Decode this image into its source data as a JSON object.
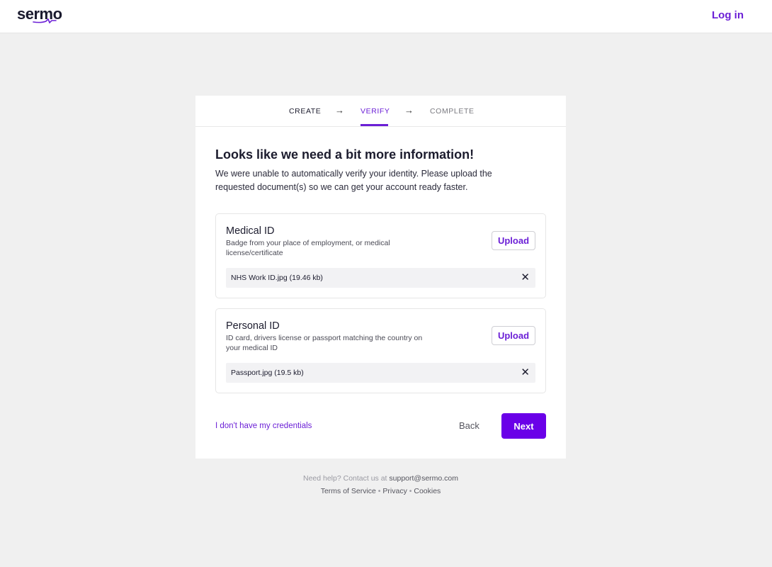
{
  "header": {
    "logo_text": "sermo",
    "login_label": "Log in"
  },
  "steps": {
    "create": "CREATE",
    "arrow": "→",
    "verify": "VERIFY",
    "complete": "COMPLETE",
    "active": "VERIFY"
  },
  "main": {
    "heading": "Looks like we need a bit more information!",
    "subtext": "We were unable to automatically verify your identity. Please upload the requested document(s) so we can get your account ready faster."
  },
  "documents": [
    {
      "title": "Medical ID",
      "description": "Badge from your place of employment, or medical license/certificate",
      "upload_label": "Upload",
      "file_name": "NHS Work ID.jpg (19.46 kb)",
      "remove_icon": "close-icon"
    },
    {
      "title": "Personal ID",
      "description": "ID card, drivers license or passport matching the country on your medical ID",
      "upload_label": "Upload",
      "file_name": "Passport.jpg (19.5 kb)",
      "remove_icon": "close-icon"
    }
  ],
  "actions": {
    "no_credentials": "I don't have my credentials",
    "back": "Back",
    "next": "Next"
  },
  "footer": {
    "help_text": "Need help? Contact us at",
    "help_email": "support@sermo.com",
    "terms": "Terms of Service",
    "privacy": "Privacy",
    "cookies": "Cookies",
    "separator": "•"
  },
  "colors": {
    "accent": "#6b1fd6",
    "next_button": "#6a00e8",
    "page_background": "#f0f0f0"
  }
}
